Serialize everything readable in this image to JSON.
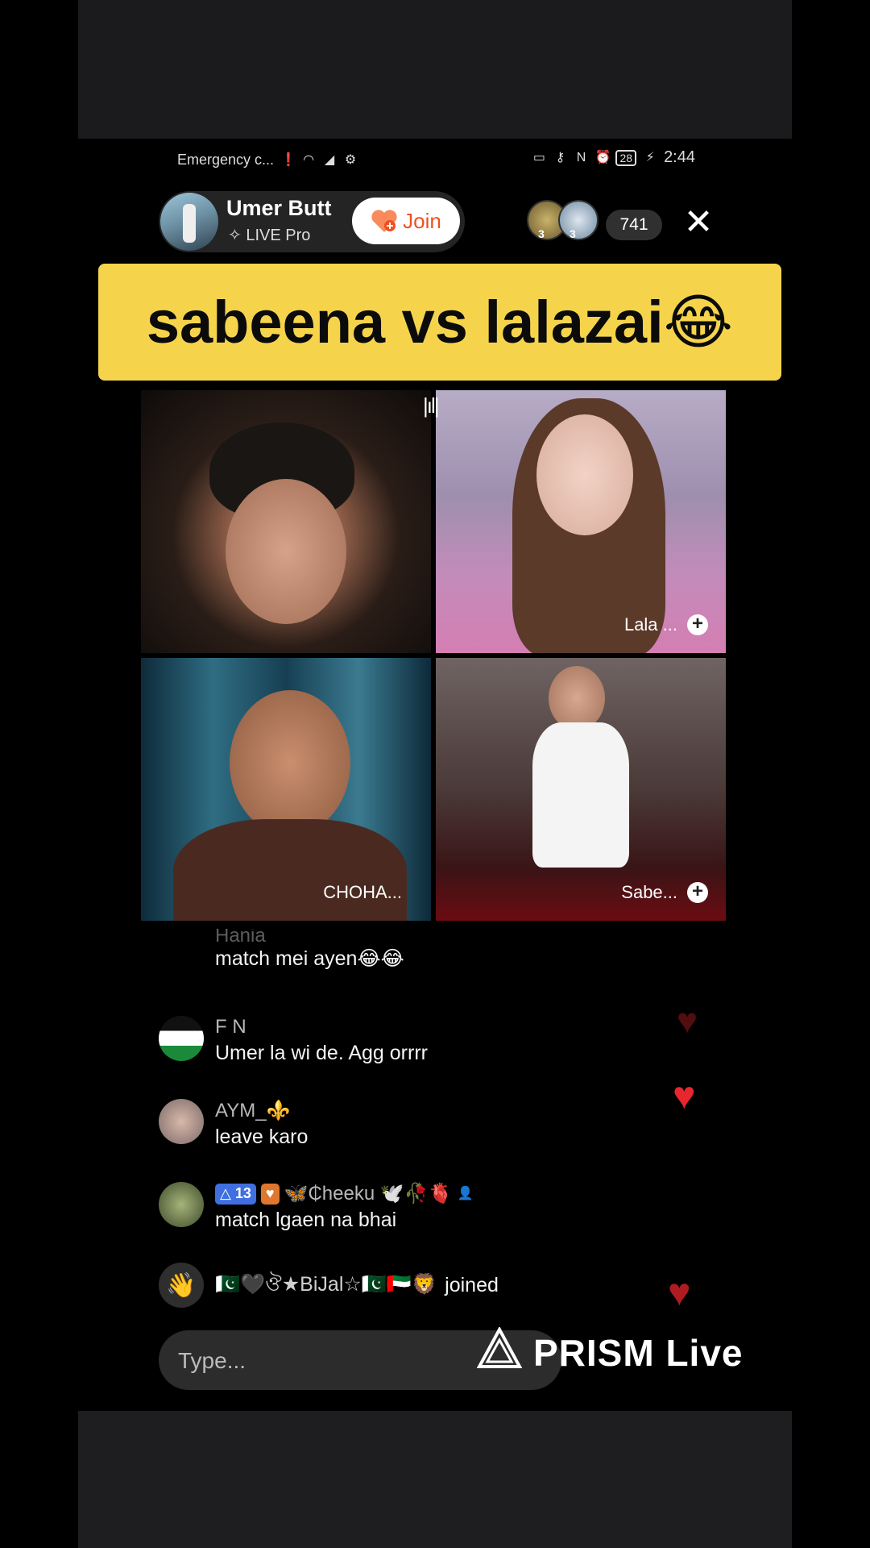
{
  "status_bar": {
    "carrier": "Emergency c...",
    "battery": "28",
    "time": "2:44"
  },
  "host": {
    "name": "Umer Butt",
    "subtitle": "✧ LIVE Pro",
    "join_label": "Join"
  },
  "viewers": {
    "badge_1": "3",
    "badge_2": "3",
    "count": "741"
  },
  "close_icon": "✕",
  "caption": "sabeena vs lalazai😂",
  "tiles": [
    {
      "label": ""
    },
    {
      "label": "Lala ..."
    },
    {
      "label": "CHOHA..."
    },
    {
      "label": "Sabe..."
    }
  ],
  "comments": [
    {
      "name": "Hania",
      "text": "match mei ayen😂😂"
    },
    {
      "name": "F N",
      "text": "Umer la wi de. Agg orrrr"
    },
    {
      "name": "AYM_⚜️",
      "text": "leave karo"
    },
    {
      "level": "13",
      "name": "🦋₵heeku 🕊️🥀🫀",
      "text": "match lgaen na bhai"
    }
  ],
  "join_event": {
    "name": "🇵🇰🖤ঔ★BiJal☆🇵🇰🇦🇪🦁",
    "text": "joined"
  },
  "input": {
    "placeholder": "Type..."
  },
  "watermark": {
    "text": "PRISM Live"
  }
}
